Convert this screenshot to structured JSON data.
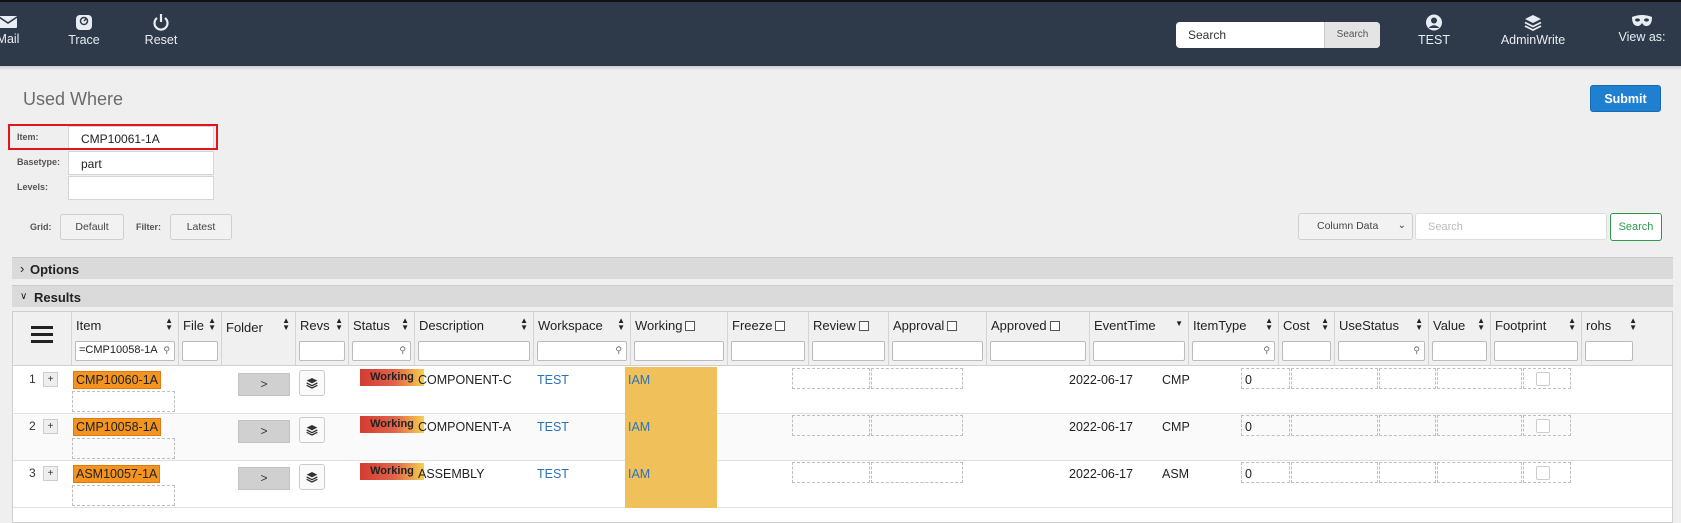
{
  "nav": {
    "items": [
      {
        "label": "Mail",
        "icon": "mail-icon"
      },
      {
        "label": "Trace",
        "icon": "trace-icon"
      },
      {
        "label": "Reset",
        "icon": "power-icon"
      }
    ],
    "search_placeholder": "Search",
    "search_button": "Search",
    "right_items": [
      {
        "label": "TEST",
        "icon": "user-icon"
      },
      {
        "label": "AdminWrite",
        "icon": "layers-icon"
      },
      {
        "label": "View as:",
        "icon": "mask-icon"
      }
    ]
  },
  "page": {
    "title": "Used Where",
    "submit_label": "Submit",
    "form": {
      "item_label": "Item:",
      "item_value": "CMP10061-1A",
      "basetype_label": "Basetype:",
      "basetype_value": "part",
      "levels_label": "Levels:",
      "levels_value": ""
    },
    "grid_label": "Grid:",
    "grid_value": "Default",
    "filter_label": "Filter:",
    "filter_value": "Latest",
    "column_select": "Column Data",
    "search_placeholder": "Search",
    "search_button": "Search"
  },
  "panels": {
    "options": "Options",
    "results": "Results"
  },
  "table": {
    "columns": [
      {
        "label": "Item",
        "filter": "=CMP10058-1A"
      },
      {
        "label": "File"
      },
      {
        "label": "Folder"
      },
      {
        "label": "Revs"
      },
      {
        "label": "Status"
      },
      {
        "label": "Description"
      },
      {
        "label": "Workspace"
      },
      {
        "label": "Working"
      },
      {
        "label": "Freeze"
      },
      {
        "label": "Review"
      },
      {
        "label": "Approval"
      },
      {
        "label": "Approved"
      },
      {
        "label": "EventTime"
      },
      {
        "label": "ItemType"
      },
      {
        "label": "Cost"
      },
      {
        "label": "UseStatus"
      },
      {
        "label": "Value"
      },
      {
        "label": "Footprint"
      },
      {
        "label": "rohs"
      }
    ],
    "rows": [
      {
        "num": "1",
        "item": "CMP10060-1A",
        "folder": ">",
        "status": "Working",
        "description": "COMPONENT-C",
        "workspace": "TEST",
        "working": "IAM",
        "eventtime": "2022-06-17",
        "itemtype": "CMP",
        "cost": "0"
      },
      {
        "num": "2",
        "item": "CMP10058-1A",
        "folder": ">",
        "status": "Working",
        "description": "COMPONENT-A",
        "workspace": "TEST",
        "working": "IAM",
        "eventtime": "2022-06-17",
        "itemtype": "CMP",
        "cost": "0"
      },
      {
        "num": "3",
        "item": "ASM10057-1A",
        "folder": ">",
        "status": "Working",
        "description": "ASSEMBLY",
        "workspace": "TEST",
        "working": "IAM",
        "eventtime": "2022-06-17",
        "itemtype": "ASM",
        "cost": "0"
      }
    ]
  }
}
